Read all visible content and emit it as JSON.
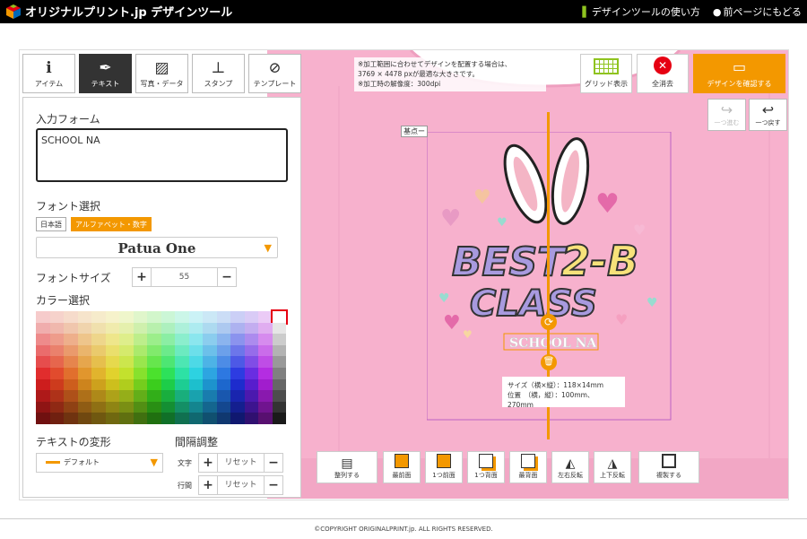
{
  "header": {
    "logo_text": "オリジナルプリント.jp デザインツール",
    "help_link": "デザインツールの使い方",
    "back_link": "前ページにもどる"
  },
  "tabs": [
    {
      "label": "アイテム",
      "icon": "info-icon"
    },
    {
      "label": "テキスト",
      "icon": "pen-icon"
    },
    {
      "label": "写真・データ",
      "icon": "image-icon"
    },
    {
      "label": "スタンプ",
      "icon": "stamp-icon"
    },
    {
      "label": "テンプレート",
      "icon": "compass-icon"
    }
  ],
  "text_panel": {
    "input_label": "入力フォーム",
    "input_value": "SCHOOL NA",
    "font_label": "フォント選択",
    "font_filter_ja": "日本語",
    "font_filter_alpha": "アルファベット・数字",
    "font_selected": "Patua One",
    "size_label": "フォントサイズ",
    "size_value": "55",
    "color_label": "カラー選択",
    "transform_label": "テキストの変形",
    "transform_value": "デフォルト",
    "spacing_label": "間隔調整",
    "char_label": "文字",
    "line_label": "行間",
    "reset_label": "リセット"
  },
  "canvas": {
    "notice_line1": "※加工範囲に合わせてデザインを配置する場合は、",
    "notice_line2": "3769 × 4478 pxが最適な大きさです。",
    "notice_line3": "※加工時の解像度：300dpi",
    "base_point_label": "基点ー",
    "grid_label": "グリッド表示",
    "clear_label": "全消去",
    "confirm_label": "デザインを確認する",
    "redo_label": "一つ進む",
    "undo_label": "一つ戻す",
    "design_best": "BEST",
    "design_class": "CLASS",
    "design_2b": "2-B",
    "selected_text": "SCHOOL NA",
    "info_size": "サイズ（横×縦）：118×14mm",
    "info_pos": "位置　（横，縦）：100mm、270mm",
    "shirt_color": "#f7b1cd",
    "accent_color": "#f39800"
  },
  "bottom_tools": [
    {
      "label": "整列する"
    },
    {
      "label": "最前面"
    },
    {
      "label": "1つ前面"
    },
    {
      "label": "1つ背面"
    },
    {
      "label": "最背面"
    },
    {
      "label": "左右反転"
    },
    {
      "label": "上下反転"
    },
    {
      "label": "複製する"
    }
  ],
  "footer": {
    "copyright": "©COPYRIGHT ORIGINALPRINT.jp. ALL RIGHTS RESERVED."
  }
}
